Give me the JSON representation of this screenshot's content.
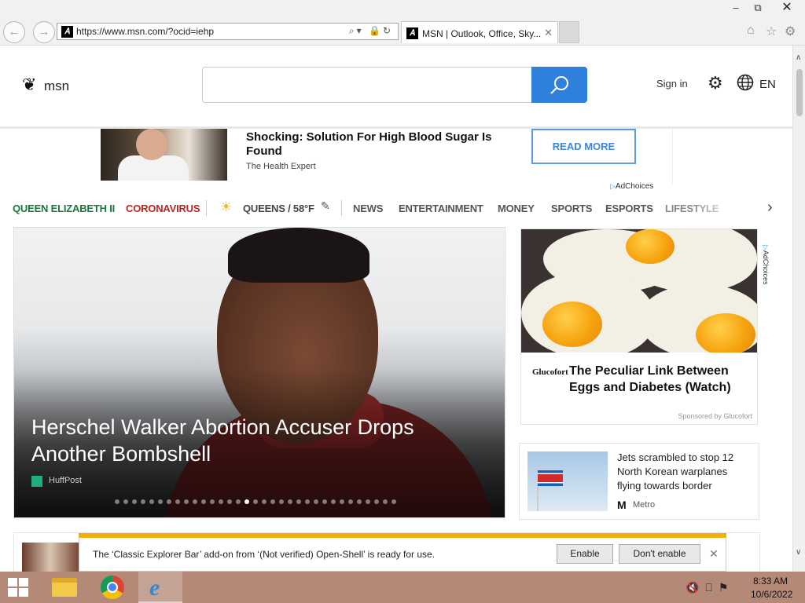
{
  "browser": {
    "url": "https://www.msn.com/?ocid=iehp",
    "tab_title": "MSN | Outlook, Office, Sky...",
    "back_icon": "back-arrow-icon",
    "forward_icon": "forward-arrow-icon"
  },
  "header": {
    "logo_text": "msn",
    "search_placeholder": "",
    "sign_in": "Sign in",
    "language": "EN"
  },
  "ad_banner": {
    "headline": "Shocking: Solution For High Blood Sugar Is Found",
    "source": "The Health Expert",
    "cta": "READ MORE",
    "adchoices": "AdChoices"
  },
  "nav": {
    "items": [
      {
        "label": "QUEEN ELIZABETH II"
      },
      {
        "label": "CORONAVIRUS"
      },
      {
        "label": "QUEENS / 58°F"
      },
      {
        "label": "NEWS"
      },
      {
        "label": "ENTERTAINMENT"
      },
      {
        "label": "MONEY"
      },
      {
        "label": "SPORTS"
      },
      {
        "label": "ESPORTS"
      },
      {
        "label": "LIFESTYLE"
      }
    ]
  },
  "hero": {
    "title": "Herschel Walker Abortion Accuser Drops Another Bombshell",
    "source": "HuffPost",
    "slide_count": 33,
    "active_slide": 15
  },
  "egg_ad": {
    "brand": "Glucofort",
    "headline": "The Peculiar Link Between Eggs and Diabetes (Watch)",
    "sponsor": "Sponsored by Glucofort",
    "adchoices": "AdChoices"
  },
  "news_card": {
    "title": "Jets scrambled to stop 12 North Korean warplanes flying towards border",
    "source": "Metro"
  },
  "notification": {
    "text": "The ‘Classic Explorer Bar’ add-on from ‘(Not verified) Open-Shell’ is ready for use.",
    "enable": "Enable",
    "dont_enable": "Don't enable"
  },
  "taskbar": {
    "time": "8:33 AM",
    "date": "10/6/2022"
  },
  "colors": {
    "accent_blue": "#2f80dc",
    "nav_green": "#137a3b",
    "nav_red": "#c0241f",
    "notify_yellow": "#f1b100",
    "taskbar": "#b48977"
  }
}
